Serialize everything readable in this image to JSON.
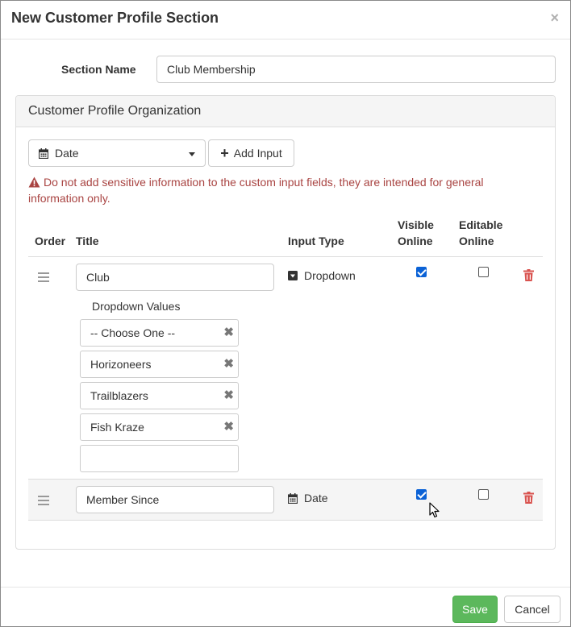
{
  "modal": {
    "title": "New Customer Profile Section",
    "close_glyph": "×"
  },
  "section_name": {
    "label": "Section Name",
    "value": "Club Membership"
  },
  "panel": {
    "title": "Customer Profile Organization",
    "type_select": {
      "value": "Date",
      "icon": "calendar-icon"
    },
    "add_input_label": "Add Input",
    "warning": "Do not add sensitive information to the custom input fields, they are intended for general information only.",
    "columns": {
      "order": "Order",
      "title": "Title",
      "input_type": "Input Type",
      "visible_online_1": "Visible",
      "visible_online_2": "Online",
      "editable_online_1": "Editable",
      "editable_online_2": "Online"
    },
    "rows": [
      {
        "title": "Club",
        "input_type": "Dropdown",
        "type_icon": "caret-square-down-icon",
        "visible_online": true,
        "editable_online": false,
        "dropdown_label": "Dropdown Values",
        "dropdown_values": [
          "-- Choose One --",
          "Horizoneers",
          "Trailblazers",
          "Fish Kraze",
          ""
        ]
      },
      {
        "title": "Member Since",
        "input_type": "Date",
        "type_icon": "calendar-icon",
        "visible_online": true,
        "editable_online": false
      }
    ]
  },
  "footer": {
    "save_label": "Save",
    "cancel_label": "Cancel"
  },
  "colors": {
    "save": "#5cb85c",
    "warning": "#a94442",
    "delete": "#d9534f",
    "checkbox": "#0b62d6"
  }
}
